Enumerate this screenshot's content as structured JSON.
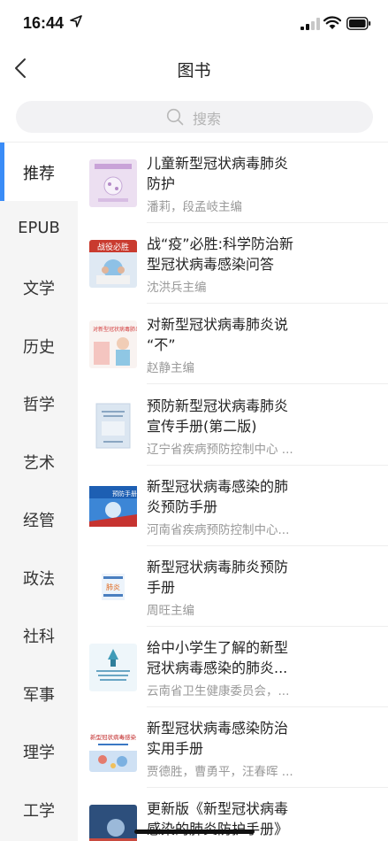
{
  "status_bar": {
    "time": "16:44"
  },
  "nav": {
    "title": "图书"
  },
  "search": {
    "placeholder": "搜索"
  },
  "categories": [
    {
      "label": "推荐",
      "active": true
    },
    {
      "label": "EPUB",
      "active": false
    },
    {
      "label": "文学",
      "active": false
    },
    {
      "label": "历史",
      "active": false
    },
    {
      "label": "哲学",
      "active": false
    },
    {
      "label": "艺术",
      "active": false
    },
    {
      "label": "经管",
      "active": false
    },
    {
      "label": "政法",
      "active": false
    },
    {
      "label": "社科",
      "active": false
    },
    {
      "label": "军事",
      "active": false
    },
    {
      "label": "理学",
      "active": false
    },
    {
      "label": "工学",
      "active": false
    }
  ],
  "books": [
    {
      "title_line1": "儿童新型冠状病毒肺炎",
      "title_line2": "防护",
      "author": "潘莉，段孟岐主编"
    },
    {
      "title_line1": "战“疫”必胜:科学防治新",
      "title_line2": "型冠状病毒感染问答",
      "author": "沈洪兵主编"
    },
    {
      "title_line1": "对新型冠状病毒肺炎说",
      "title_line2": "“不”",
      "author": "赵静主编"
    },
    {
      "title_line1": "预防新型冠状病毒肺炎",
      "title_line2": "宣传手册(第二版)",
      "author": "辽宁省疾病预防控制中心 ..."
    },
    {
      "title_line1": "新型冠状病毒感染的肺",
      "title_line2": "炎预防手册",
      "author": "河南省疾病预防控制中心..."
    },
    {
      "title_line1": "新型冠状病毒肺炎预防",
      "title_line2": "手册",
      "author": "周旺主编"
    },
    {
      "title_line1": "给中小学生了解的新型",
      "title_line2": "冠状病毒感染的肺炎...",
      "author": "云南省卫生健康委员会，..."
    },
    {
      "title_line1": "新型冠状病毒感染防治",
      "title_line2": "实用手册",
      "author": "贾德胜，曹勇平，汪春晖 ..."
    },
    {
      "title_line1": "更新版《新型冠状病毒",
      "title_line2": "感染的肺炎防护手册》",
      "author": ""
    }
  ],
  "cover_text": {
    "c2": "战役必胜",
    "c3": "对新型冠状病毒肺炎说不",
    "c5": "预防手册",
    "c6": "肺炎",
    "c8": "新型冠状病毒感染"
  }
}
